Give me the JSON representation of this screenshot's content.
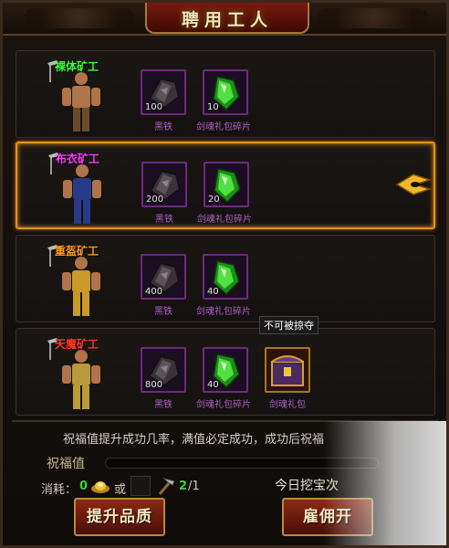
{
  "title": "聘用工人",
  "colors": {
    "accent_orange": "#e3931b",
    "name_green": "#39ff3a",
    "name_magenta": "#ff3cff",
    "name_orange": "#ff9a1a",
    "name_red": "#ff3a2a",
    "item_label_purple": "#b05dc8",
    "count_green": "#39d03a"
  },
  "workers": [
    {
      "name": "裸体矿工",
      "name_color": "#39ff3a",
      "figure_icon": "naked-miner-figure",
      "items": [
        {
          "icon": "black-iron-ore-icon",
          "qty": "100",
          "label": "黑铁"
        },
        {
          "icon": "green-crystal-icon",
          "qty": "10",
          "label": "剑魂礼包碎片"
        }
      ]
    },
    {
      "name": "布衣矿工",
      "name_color": "#ff3cff",
      "figure_icon": "cloth-miner-figure",
      "selected": true,
      "items": [
        {
          "icon": "black-iron-ore-icon",
          "qty": "200",
          "label": "黑铁"
        },
        {
          "icon": "green-crystal-icon",
          "qty": "20",
          "label": "剑魂礼包碎片"
        }
      ]
    },
    {
      "name": "重盔矿工",
      "name_color": "#ff9a1a",
      "figure_icon": "heavy-armor-miner-figure",
      "items": [
        {
          "icon": "black-iron-ore-icon",
          "qty": "400",
          "label": "黑铁"
        },
        {
          "icon": "green-crystal-icon",
          "qty": "40",
          "label": "剑魂礼包碎片"
        }
      ]
    },
    {
      "name": "天魔矿工",
      "name_color": "#ff3a2a",
      "figure_icon": "demon-miner-figure",
      "items": [
        {
          "icon": "black-iron-ore-icon",
          "qty": "800",
          "label": "黑铁"
        },
        {
          "icon": "green-crystal-icon",
          "qty": "40",
          "label": "剑魂礼包碎片"
        },
        {
          "icon": "treasure-chest-icon",
          "qty": "",
          "label": "剑魂礼包"
        }
      ],
      "tag": "不可被掠夺"
    }
  ],
  "blessing": {
    "desc": "祝福值提升成功几率，满值必定成功，成功后祝福",
    "label": "祝福值",
    "fill": 0.0
  },
  "cost": {
    "label": "消耗：",
    "gold_count": "0",
    "or": "或",
    "pick_have": "2",
    "pick_need": "/1"
  },
  "daily_label": "今日挖宝次",
  "buttons": {
    "upgrade": "提升品质",
    "hire": "雇佣开"
  }
}
